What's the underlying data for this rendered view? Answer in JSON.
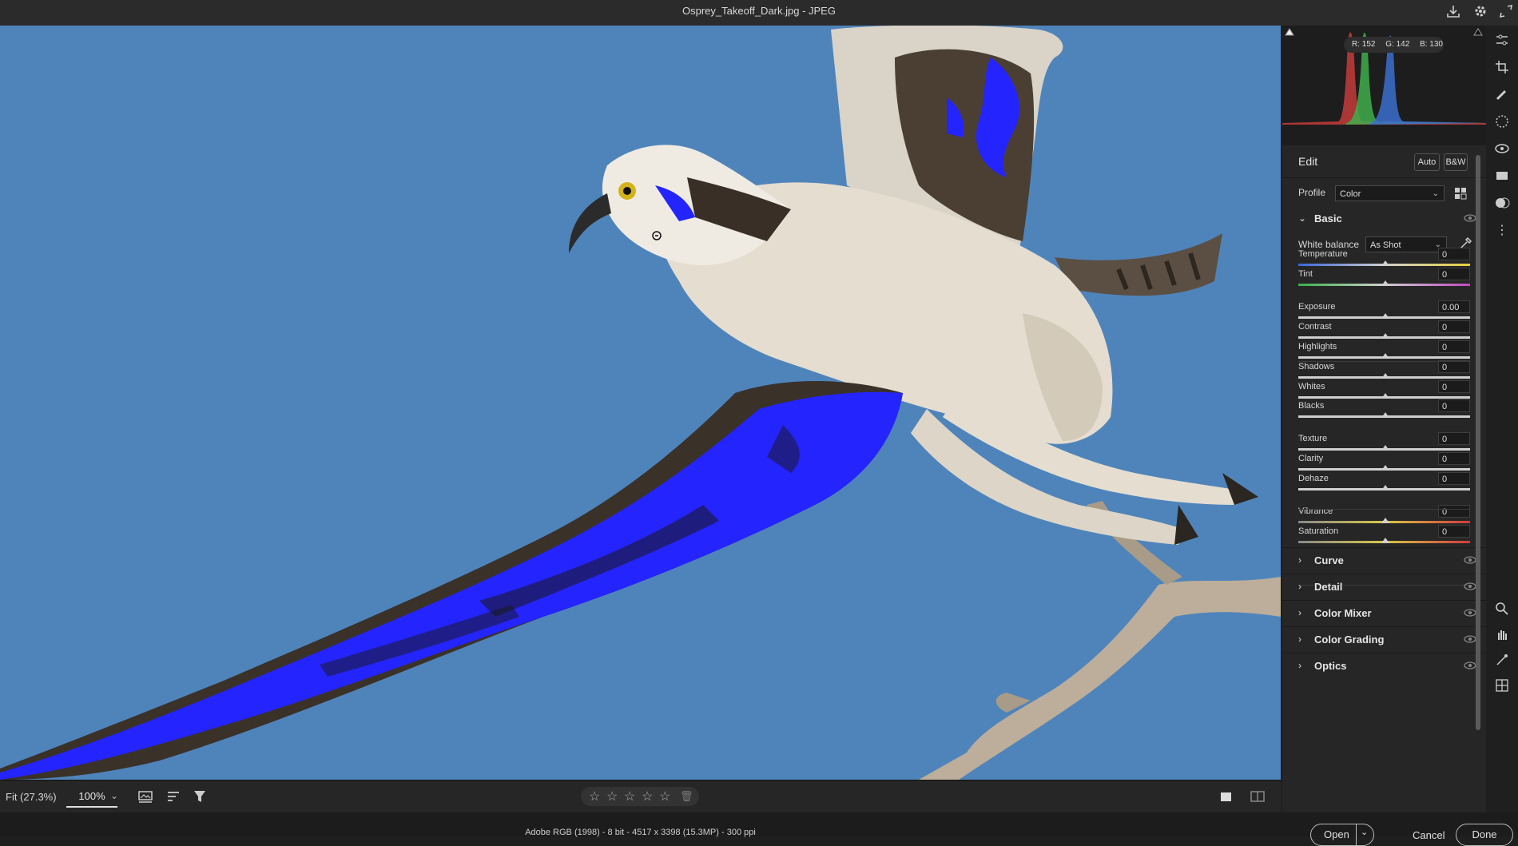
{
  "window": {
    "title": "Osprey_Takeoff_Dark.jpg  -  JPEG"
  },
  "histogram": {
    "readout": {
      "r": "R: 152",
      "g": "G: 142",
      "b": "B: 130"
    }
  },
  "edit": {
    "title": "Edit",
    "auto_label": "Auto",
    "bw_label": "B&W",
    "profile_label": "Profile",
    "profile_value": "Color"
  },
  "basic": {
    "title": "Basic",
    "white_balance_label": "White balance",
    "white_balance_value": "As Shot",
    "sliders": [
      {
        "label": "Temperature",
        "value": "0"
      },
      {
        "label": "Tint",
        "value": "0"
      },
      {
        "label": "Exposure",
        "value": "0.00"
      },
      {
        "label": "Contrast",
        "value": "0"
      },
      {
        "label": "Highlights",
        "value": "0"
      },
      {
        "label": "Shadows",
        "value": "0"
      },
      {
        "label": "Whites",
        "value": "0"
      },
      {
        "label": "Blacks",
        "value": "0"
      },
      {
        "label": "Texture",
        "value": "0"
      },
      {
        "label": "Clarity",
        "value": "0"
      },
      {
        "label": "Dehaze",
        "value": "0"
      },
      {
        "label": "Vibrance",
        "value": "0"
      },
      {
        "label": "Saturation",
        "value": "0"
      }
    ]
  },
  "sections": [
    "Curve",
    "Detail",
    "Color Mixer",
    "Color Grading",
    "Optics"
  ],
  "bottom": {
    "fit_label": "Fit (27.3%)",
    "zoom_label": "100%"
  },
  "status": {
    "info": "Adobe RGB (1998) - 8 bit - 4517 x 3398 (15.3MP) - 300 ppi",
    "open_label": "Open",
    "cancel_label": "Cancel",
    "done_label": "Done"
  },
  "colors": {
    "sky": "#4f84bb",
    "clipping": "#2424ff",
    "panel": "#262626"
  }
}
